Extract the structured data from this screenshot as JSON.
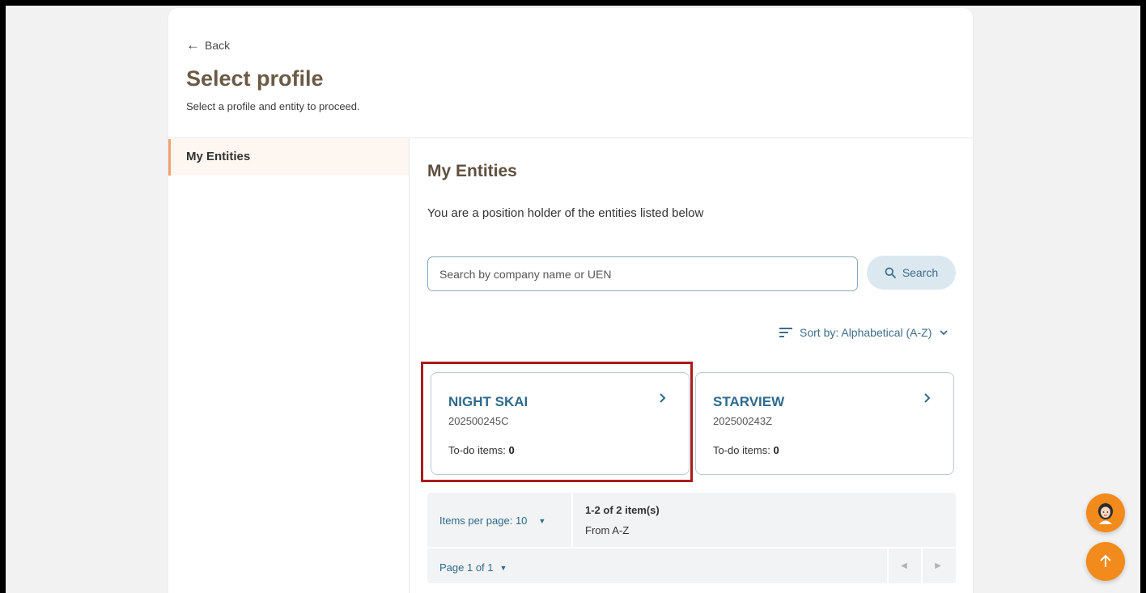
{
  "header": {
    "back_label": "Back",
    "title": "Select profile",
    "subtitle": "Select a profile and entity to proceed."
  },
  "sidebar": {
    "items": [
      {
        "label": "My Entities",
        "active": true
      }
    ]
  },
  "main": {
    "title": "My Entities",
    "description": "You are a position holder of the entities listed below",
    "search": {
      "placeholder": "Search by company name or UEN",
      "value": "",
      "button_label": "Search"
    },
    "sort": {
      "label": "Sort by: Alphabetical (A-Z)"
    },
    "entities": [
      {
        "name": "NIGHT SKAI",
        "uen": "202500245C",
        "todo_label": "To-do items:",
        "todo_count": "0",
        "highlighted": true
      },
      {
        "name": "STARVIEW",
        "uen": "202500243Z",
        "todo_label": "To-do items:",
        "todo_count": "0",
        "highlighted": false
      }
    ],
    "pagination": {
      "items_per_page_label": "Items per page: 10",
      "range_label": "1-2 of 2 item(s)",
      "order_label": "From A-Z",
      "page_label": "Page 1 of 1"
    }
  },
  "colors": {
    "accent": "#2f6a8c",
    "title_brown": "#6b5a45",
    "highlight_red": "#a81c1c",
    "fab_orange": "#f28a1c"
  },
  "icons": {
    "back": "arrow-left-icon",
    "search": "search-icon",
    "sort": "sort-lines-icon",
    "chevron": "chevron-right-icon",
    "chat": "assistant-avatar-icon",
    "top": "arrow-up-icon"
  }
}
